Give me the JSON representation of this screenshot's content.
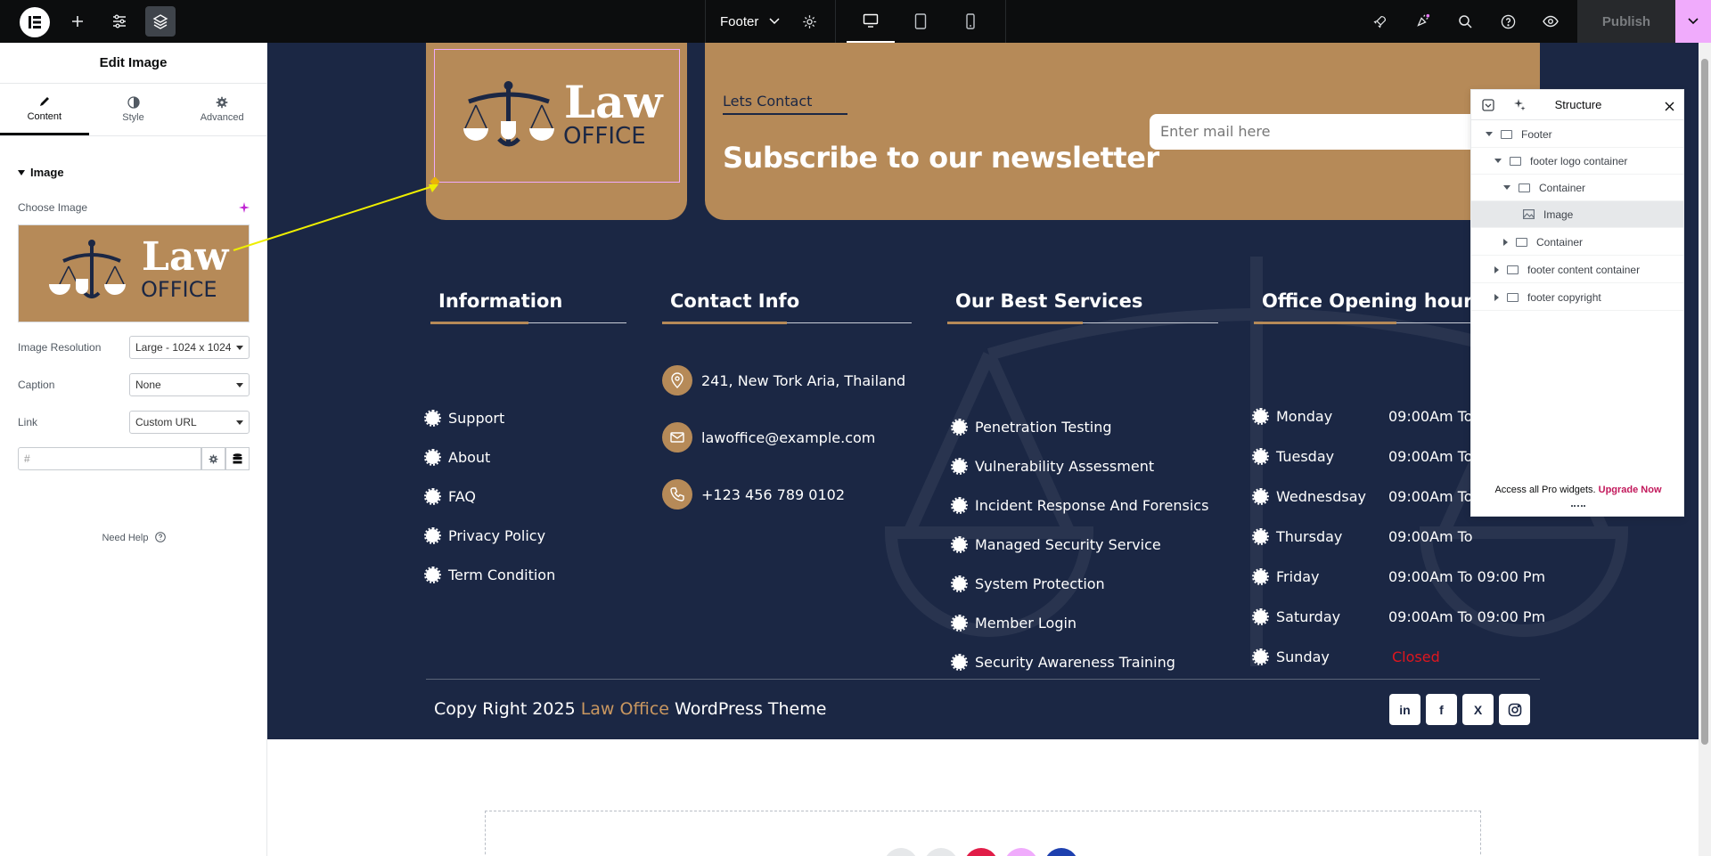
{
  "topbar": {
    "document_title": "Footer",
    "publish_label": "Publish"
  },
  "panel": {
    "title": "Edit Image",
    "tabs": [
      {
        "label": "Content",
        "active": true
      },
      {
        "label": "Style",
        "active": false
      },
      {
        "label": "Advanced",
        "active": false
      }
    ],
    "section_title": "Image",
    "choose_image_label": "Choose Image",
    "image_resolution_label": "Image Resolution",
    "image_resolution_value": "Large - 1024 x 1024",
    "caption_label": "Caption",
    "caption_value": "None",
    "link_label": "Link",
    "link_value": "Custom URL",
    "url_placeholder": "#",
    "need_help": "Need Help"
  },
  "logo": {
    "line1": "Law",
    "line2": "OFFICE"
  },
  "newsletter": {
    "eyebrow": "Lets Contact",
    "title": "Subscribe to our newsletter",
    "input_placeholder": "Enter mail here"
  },
  "columns": {
    "information": {
      "heading": "Information",
      "items": [
        "Support",
        "About",
        "FAQ",
        "Privacy Policy",
        "Term Condition"
      ]
    },
    "contact": {
      "heading": "Contact Info",
      "items": [
        {
          "icon": "map-pin-icon",
          "text": "241, New Tork Aria, Thailand"
        },
        {
          "icon": "mail-icon",
          "text": "lawoffice@example.com"
        },
        {
          "icon": "phone-icon",
          "text": "+123 456 789 0102"
        }
      ]
    },
    "services": {
      "heading": "Our Best Services",
      "items": [
        "Penetration Testing",
        "Vulnerability Assessment",
        "Incident Response And Forensics",
        "Managed Security Service",
        "System Protection",
        "Member Login",
        "Security Awareness Training"
      ]
    },
    "hours": {
      "heading": "Office Opening hours",
      "rows": [
        {
          "day": "Monday",
          "time": "09:00Am To"
        },
        {
          "day": "Tuesday",
          "time": "09:00Am To"
        },
        {
          "day": "Wednesdsay",
          "time": "09:00Am To"
        },
        {
          "day": "Thursday",
          "time": "09:00Am To"
        },
        {
          "day": "Friday",
          "time": "09:00Am To 09:00 Pm"
        },
        {
          "day": "Saturday",
          "time": "09:00Am To 09:00 Pm"
        },
        {
          "day": "Sunday",
          "time": "Closed"
        }
      ]
    }
  },
  "copyright": {
    "prefix": "Copy Right 2025 ",
    "brand": "Law Office",
    "suffix": " WordPress Theme"
  },
  "social": [
    "in",
    "f",
    "X",
    "ig"
  ],
  "structure": {
    "title": "Structure",
    "rows": [
      {
        "label": "Footer"
      },
      {
        "label": "footer logo container"
      },
      {
        "label": "Container"
      },
      {
        "label": "Image"
      },
      {
        "label": "Container"
      },
      {
        "label": "footer content container"
      },
      {
        "label": "footer copyright"
      }
    ],
    "promo_text": "Access all Pro widgets.",
    "promo_link": "Upgrade Now"
  },
  "colors": {
    "navy": "#1b2744",
    "gold": "#b68a58",
    "accent_pink": "#f0abfc",
    "closed_red": "#e0161e"
  }
}
